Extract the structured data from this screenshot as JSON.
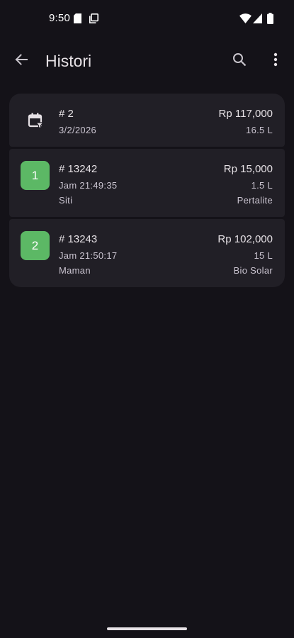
{
  "status_bar": {
    "time": "9:50"
  },
  "app_bar": {
    "title": "Histori"
  },
  "summary": {
    "number": "# 2",
    "date": "3/2/2026",
    "amount": "Rp 117,000",
    "volume": "16.5 L"
  },
  "transactions": [
    {
      "index": "1",
      "number": "# 13242",
      "time": "Jam 21:49:35",
      "name": "Siti",
      "amount": "Rp 15,000",
      "volume": "1.5 L",
      "fuel": "Pertalite"
    },
    {
      "index": "2",
      "number": "# 13243",
      "time": "Jam 21:50:17",
      "name": "Maman",
      "amount": "Rp 102,000",
      "volume": "15 L",
      "fuel": "Bio Solar"
    }
  ],
  "colors": {
    "background": "#141218",
    "card": "#211f26",
    "badge": "#5cb865"
  },
  "icons": [
    "back-arrow-icon",
    "search-icon",
    "more-vert-icon",
    "calendar-filter-icon",
    "sim-card-icon",
    "screenshot-icon",
    "wifi-icon",
    "cell-signal-icon",
    "battery-icon"
  ]
}
